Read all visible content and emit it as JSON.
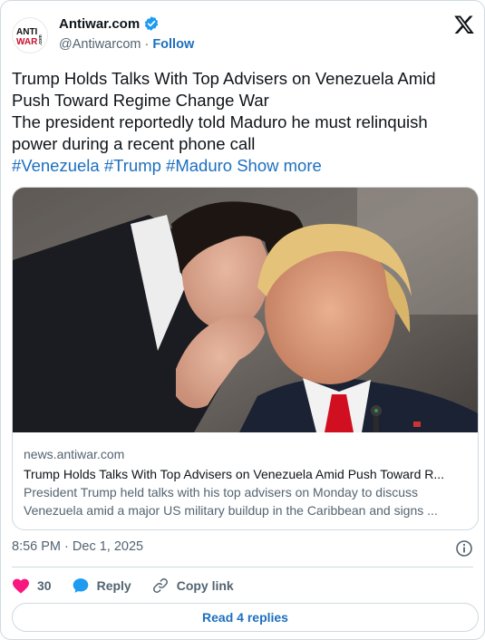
{
  "account": {
    "display_name": "Antiwar.com",
    "handle": "@Antiwarcom",
    "separator": "·",
    "follow_label": "Follow",
    "logo_text_top": "ANTI",
    "logo_text_bottom": "WAR",
    "logo_text_side": ".com"
  },
  "tweet": {
    "line1": "Trump Holds Talks With Top Advisers on Venezuela Amid",
    "line2": "Push Toward Regime Change War",
    "line3": "The president reportedly told Maduro he must relinquish",
    "line4": "power during a recent phone call",
    "hashtags": [
      "#Venezuela",
      "#Trump",
      "#Maduro"
    ],
    "show_more_label": "Show more"
  },
  "link_card": {
    "domain": "news.antiwar.com",
    "title": "Trump Holds Talks With Top Advisers on Venezuela Amid Push Toward R...",
    "description_line1": "President Trump held talks with his top advisers on Monday to discuss",
    "description_line2": "Venezuela amid a major US military buildup in the Caribbean and signs ..."
  },
  "timestamp": {
    "time": "8:56 PM",
    "separator": "·",
    "date": "Dec 1, 2025"
  },
  "actions": {
    "like_count": "30",
    "reply_label": "Reply",
    "copy_link_label": "Copy link"
  },
  "replies_button_label": "Read 4 replies",
  "colors": {
    "accent": "#1d6fbf",
    "like": "#f91880",
    "text": "#0f1419",
    "muted": "#536471",
    "border": "#cfd9de"
  }
}
